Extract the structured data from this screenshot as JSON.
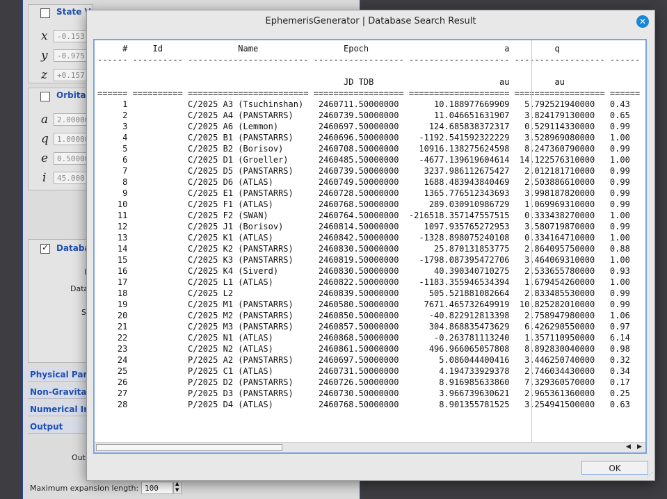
{
  "background_app": {
    "state_vector_label": "State V",
    "orbital_label": "Orbital",
    "database_label": "Databa",
    "state_vars": [
      {
        "symbol": "x",
        "value": "-0.153"
      },
      {
        "symbol": "y",
        "value": "-0.975"
      },
      {
        "symbol": "z",
        "value": "+0.157"
      }
    ],
    "orbital_vars": [
      {
        "symbol": "a",
        "value": "2.00000"
      },
      {
        "symbol": "q",
        "value": "1.00000"
      },
      {
        "symbol": "e",
        "value": "0.50000"
      },
      {
        "symbol": "i",
        "value": "45.000"
      }
    ],
    "stub_labels": [
      "I",
      "Data",
      "S",
      "Out"
    ],
    "sections": [
      "Physical Para",
      "Non-Gravitat",
      "Numerical Int",
      "Output"
    ],
    "max_expansion_label": "Maximum expansion length:",
    "max_expansion_value": "100"
  },
  "dialog": {
    "title": "EphemerisGenerator | Database Search Result",
    "ok_label": "OK",
    "table": {
      "columns": [
        "#",
        "Id",
        "Name",
        "Epoch",
        "a",
        "q"
      ],
      "units": [
        "",
        "",
        "",
        "JD TDB",
        "au",
        "au"
      ],
      "rows": [
        [
          "1",
          "",
          "C/2025 A3 (Tsuchinshan)",
          "2460711.50000000",
          "10.188977669909",
          "5.792521940000",
          "0.43"
        ],
        [
          "2",
          "",
          "C/2025 A4 (PANSTARRS)",
          "2460739.50000000",
          "11.046651631907",
          "3.824179130000",
          "0.65"
        ],
        [
          "3",
          "",
          "C/2025 A6 (Lemmon)",
          "2460697.50000000",
          "124.685838372317",
          "0.529114330000",
          "0.99"
        ],
        [
          "4",
          "",
          "C/2025 B1 (PANSTARRS)",
          "2460696.50000000",
          "-1192.541592322229",
          "3.528969080000",
          "1.00"
        ],
        [
          "5",
          "",
          "C/2025 B2 (Borisov)",
          "2460708.50000000",
          "10916.138275624598",
          "8.247360790000",
          "0.99"
        ],
        [
          "6",
          "",
          "C/2025 D1 (Groeller)",
          "2460485.50000000",
          "-4677.139619604614",
          "14.122576310000",
          "1.00"
        ],
        [
          "7",
          "",
          "C/2025 D5 (PANSTARRS)",
          "2460739.50000000",
          "3237.986112675427",
          "2.012181710000",
          "0.99"
        ],
        [
          "8",
          "",
          "C/2025 D6 (ATLAS)",
          "2460749.50000000",
          "1688.483943840469",
          "2.503886610000",
          "0.99"
        ],
        [
          "9",
          "",
          "C/2025 E1 (PANSTARRS)",
          "2460728.50000000",
          "1365.776512343693",
          "3.998187820000",
          "0.99"
        ],
        [
          "10",
          "",
          "C/2025 F1 (ATLAS)",
          "2460768.50000000",
          "289.030910986729",
          "1.069969310000",
          "0.99"
        ],
        [
          "11",
          "",
          "C/2025 F2 (SWAN)",
          "2460764.50000000",
          "-216518.357147557515",
          "0.333438270000",
          "1.00"
        ],
        [
          "12",
          "",
          "C/2025 J1 (Borisov)",
          "2460814.50000000",
          "1097.935765272953",
          "3.580719870000",
          "0.99"
        ],
        [
          "13",
          "",
          "C/2025 K1 (ATLAS)",
          "2460842.50000000",
          "-1328.898075240108",
          "0.334164710000",
          "1.00"
        ],
        [
          "14",
          "",
          "C/2025 K2 (PANSTARRS)",
          "2460830.50000000",
          "25.870131853775",
          "2.864095750000",
          "0.88"
        ],
        [
          "15",
          "",
          "C/2025 K3 (PANSTARRS)",
          "2460819.50000000",
          "-1798.087395472706",
          "3.464069310000",
          "1.00"
        ],
        [
          "16",
          "",
          "C/2025 K4 (Siverd)",
          "2460830.50000000",
          "40.390340710275",
          "2.533655780000",
          "0.93"
        ],
        [
          "17",
          "",
          "C/2025 L1 (ATLAS)",
          "2460822.50000000",
          "-1183.355946534394",
          "1.679454260000",
          "1.00"
        ],
        [
          "18",
          "",
          "C/2025 L2",
          "2460839.50000000",
          "505.521881082664",
          "2.833485530000",
          "0.99"
        ],
        [
          "19",
          "",
          "C/2025 M1 (PANSTARRS)",
          "2460580.50000000",
          "7671.465732649919",
          "10.825282010000",
          "0.99"
        ],
        [
          "20",
          "",
          "C/2025 M2 (PANSTARRS)",
          "2460850.50000000",
          "-40.822912813398",
          "2.758947980000",
          "1.06"
        ],
        [
          "21",
          "",
          "C/2025 M3 (PANSTARRS)",
          "2460857.50000000",
          "304.868835473629",
          "6.426290550000",
          "0.97"
        ],
        [
          "22",
          "",
          "C/2025 N1 (ATLAS)",
          "2460868.50000000",
          "-0.263781113240",
          "1.357110950000",
          "6.14"
        ],
        [
          "23",
          "",
          "C/2025 N2 (ATLAS)",
          "2460861.50000000",
          "496.966065057808",
          "8.892830040000",
          "0.98"
        ],
        [
          "24",
          "",
          "P/2025 A2 (PANSTARRS)",
          "2460697.50000000",
          "5.086044400416",
          "3.446250740000",
          "0.32"
        ],
        [
          "25",
          "",
          "P/2025 C1 (ATLAS)",
          "2460731.50000000",
          "4.194733929378",
          "2.746034430000",
          "0.34"
        ],
        [
          "26",
          "",
          "P/2025 D2 (PANSTARRS)",
          "2460726.50000000",
          "8.916985633860",
          "7.329360570000",
          "0.17"
        ],
        [
          "27",
          "",
          "P/2025 D3 (PANSTARRS)",
          "2460730.50000000",
          "3.966739630621",
          "2.965361360000",
          "0.25"
        ],
        [
          "28",
          "",
          "P/2025 D4 (ATLAS)",
          "2460768.50000000",
          "8.901355781525",
          "3.254941500000",
          "0.63"
        ]
      ]
    }
  },
  "colors": {
    "accent_blue": "#1f4fb0",
    "close_button": "#1a87d6",
    "focus_border": "#7aa3e0"
  },
  "icons": [
    "close-icon",
    "checkbox-icon",
    "scroll-left-icon",
    "scroll-right-icon",
    "spinner-up-icon",
    "spinner-down-icon",
    "resize-grip-icon"
  ]
}
